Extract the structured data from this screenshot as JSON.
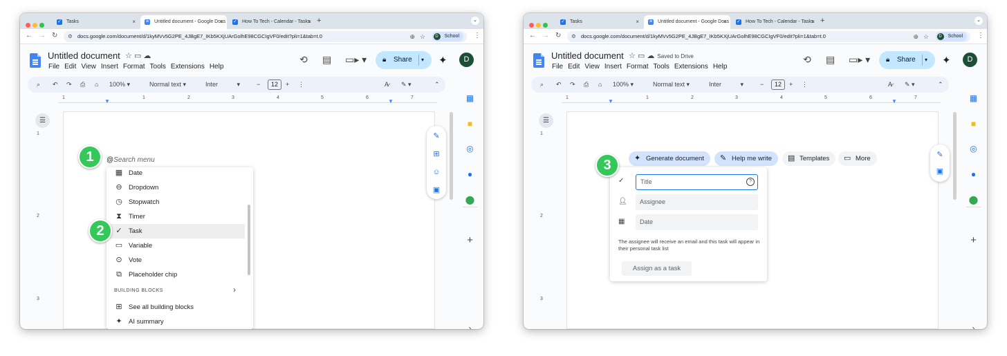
{
  "browser": {
    "tabs": [
      "Tasks",
      "Untitled document - Google Docs",
      "How To Tech - Calendar - Tasks"
    ],
    "url": "docs.google.com/document/d/1kyMVv5G2PE_4JBgE7_IKb5KXjUArGolhE98CGCIgVF0/edit?pli=1&tab=t.0",
    "profile": "School",
    "profile_initial": "D"
  },
  "doc": {
    "title": "Untitled document",
    "saved_status": "Saved to Drive",
    "menus": [
      "File",
      "Edit",
      "View",
      "Insert",
      "Format",
      "Tools",
      "Extensions",
      "Help"
    ],
    "share_label": "Share",
    "user_initial": "D"
  },
  "toolbar": {
    "zoom": "100%",
    "style": "Normal text",
    "font": "Inter",
    "font_size": "12"
  },
  "ruler": {
    "marks": [
      "1",
      "1",
      "2",
      "3",
      "4",
      "5",
      "6",
      "7"
    ],
    "vmarks": [
      "1",
      "2",
      "3"
    ]
  },
  "steps": [
    "1",
    "2",
    "3"
  ],
  "at_menu": {
    "prefix": "@",
    "placeholder": "Search menu",
    "items": [
      "Date",
      "Dropdown",
      "Stopwatch",
      "Timer",
      "Task",
      "Variable",
      "Vote",
      "Placeholder chip"
    ],
    "section": "BUILDING BLOCKS",
    "footer_items": [
      "See all building blocks",
      "AI summary"
    ]
  },
  "chips": [
    "Generate document",
    "Help me write",
    "Templates",
    "More"
  ],
  "task_card": {
    "title_placeholder": "Title",
    "assignee_placeholder": "Assignee",
    "date_placeholder": "Date",
    "note": "The assignee will receive an email and this task will appear in their personal task list",
    "assign_button": "Assign as a task"
  },
  "colors": {
    "step_badge": "#34c759",
    "share": "#c2e7ff",
    "accent": "#1a73e8",
    "docs_blue": "#4285f4"
  },
  "icons": [
    "back-icon",
    "forward-icon",
    "reload-icon",
    "star-icon",
    "move-icon",
    "cloud-icon",
    "history-icon",
    "comment-icon",
    "meet-icon",
    "gemini-icon",
    "search-icon",
    "undo-icon",
    "redo-icon",
    "print-icon",
    "paint-format-icon",
    "spellcheck-icon",
    "pencil-icon",
    "outline-icon",
    "calendar-icon",
    "keep-icon",
    "tasks-icon",
    "contacts-icon",
    "maps-icon",
    "plus-icon"
  ]
}
